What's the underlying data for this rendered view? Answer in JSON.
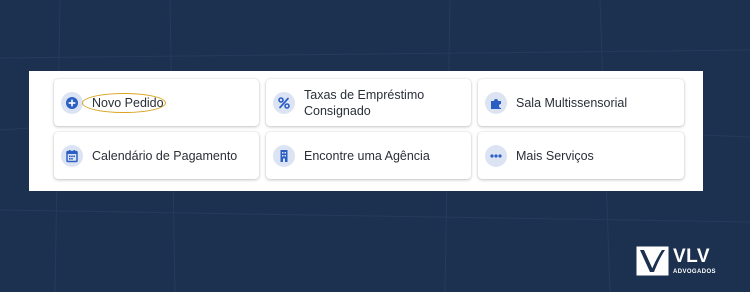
{
  "colors": {
    "background": "#1c3150",
    "panel": "#ffffff",
    "icon_bg": "#dce4f3",
    "icon_fg": "#2b5fc4",
    "text": "#2a2f38",
    "highlight": "#d9a321"
  },
  "services": [
    {
      "label": "Novo Pedido",
      "icon": "plus-circle-icon"
    },
    {
      "label": "Taxas de Empréstimo\nConsignado",
      "icon": "percent-icon"
    },
    {
      "label": "Sala Multissensorial",
      "icon": "puzzle-icon"
    },
    {
      "label": "Calendário de Pagamento",
      "icon": "calendar-icon"
    },
    {
      "label": "Encontre uma Agência",
      "icon": "building-icon"
    },
    {
      "label": "Mais Serviços",
      "icon": "more-dots-icon"
    }
  ],
  "logo": {
    "title": "VLV",
    "subtitle": "ADVOGADOS"
  }
}
